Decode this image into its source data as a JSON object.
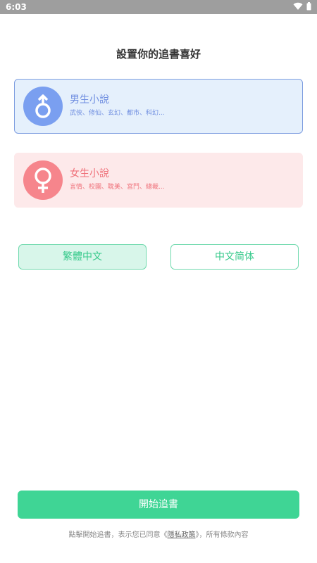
{
  "status_bar": {
    "time": "6:03",
    "icons": [
      "wifi-icon",
      "battery-icon"
    ]
  },
  "page": {
    "title": "設置你的追書喜好"
  },
  "genders": [
    {
      "title": "男生小說",
      "subtitle": "武俠、修仙、玄幻、都市、科幻...",
      "icon": "male-symbol-icon",
      "accent": "#7a9ff0",
      "selected": true
    },
    {
      "title": "女生小說",
      "subtitle": "言情、校園、耽美、宮鬥、總裁...",
      "icon": "female-symbol-icon",
      "accent": "#f6858c",
      "selected": false
    }
  ],
  "languages": [
    {
      "label": "繁體中文",
      "selected": true
    },
    {
      "label": "中文简体",
      "selected": false
    }
  ],
  "start_button": {
    "label": "開始追書"
  },
  "footer": {
    "prefix": "點擊開始追書，表示您已同意《",
    "link": "隱私政策",
    "suffix": "》，所有條款內容"
  },
  "colors": {
    "accent_green": "#3fd595",
    "male_blue": "#7a9ff0",
    "female_pink": "#f6858c"
  }
}
